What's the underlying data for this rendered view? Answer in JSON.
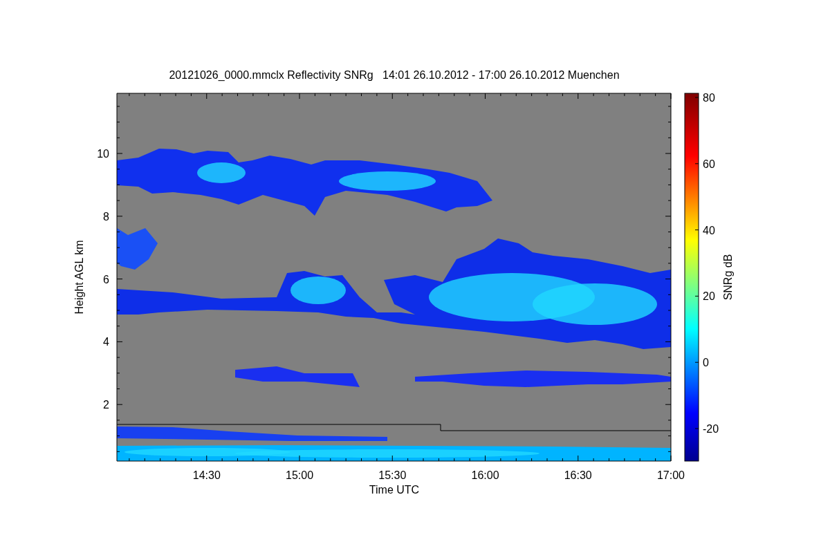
{
  "chart": {
    "title": "20121026_0000.mmclx Reflectivity SNRg   14:01 26.10.2012 - 17:00 26.10.2012 Muenchen",
    "xlabel": "Time UTC",
    "ylabel": "Height AGL km",
    "xticks": [
      "14:30",
      "15:00",
      "15:30",
      "16:00",
      "16:30",
      "17:00"
    ],
    "yticks": [
      "10",
      "8",
      "6",
      "4",
      "2"
    ]
  },
  "colorbar": {
    "label": "SNRg dB",
    "ticks": [
      "80",
      "60",
      "40",
      "20",
      "0",
      "-20"
    ]
  }
}
